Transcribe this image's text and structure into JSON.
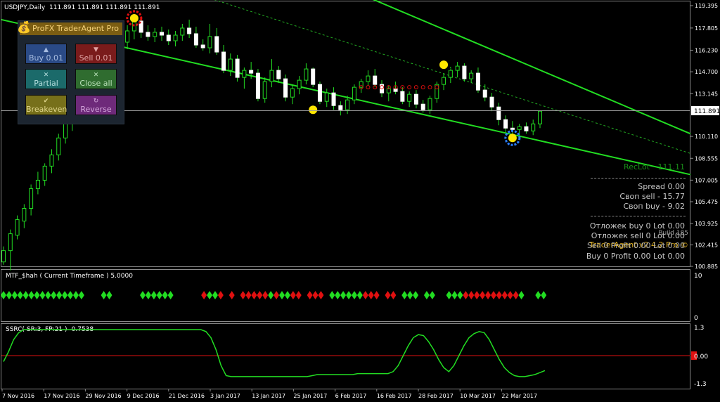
{
  "header": {
    "symbol_title": "USDJPY,Daily",
    "ohlc": "111.891 111.891 111.891 111.891"
  },
  "panel": {
    "title": "ProFX TraderAgent Pro",
    "buy_label": "Buy 0.01",
    "sell_label": "Sell 0.01",
    "partial_label": "Partial",
    "close_all_label": "Close all",
    "breakeven_label": "Breakeven",
    "reverse_label": "Reverse",
    "icons": {
      "buy": "arrow-up",
      "sell": "arrow-down",
      "partial": "x-mark",
      "close_all": "x-mark",
      "breakeven": "check-mark",
      "reverse": "circular-arrows"
    }
  },
  "price_axis": {
    "ticks": [
      "119.395",
      "117.805",
      "116.230",
      "114.700",
      "113.145",
      "111.891",
      "110.110",
      "108.555",
      "107.005",
      "105.475",
      "103.925",
      "102.415",
      "100.885"
    ],
    "current_price": "111.891"
  },
  "info": {
    "reclot": "RecLot",
    "reclot_value": "111.11",
    "spread": "Spread    0.00",
    "swap_sell": "Своп sell  - 15.77",
    "swap_buy": "Своп buy  - 9.02",
    "pending_buy": "Отложек buy 0  Lot 0.00",
    "pending_sell": "Отложек sell 0  Lot 0.00",
    "build": "Build 185",
    "version": "TraderAgent v2.4.2 Pro ©",
    "sell_line": "Sell 0  Profit 0.00  Lot 0.00",
    "buy_line": "Buy 0  Profit 0.00  Lot 0.00"
  },
  "indicator1": {
    "title": "MTF_$hah ( Current Timeframe )  5.0000",
    "scale_top": "10",
    "scale_bottom": "0",
    "colors": "GGGGGGGGGGGGGGG   GG     GGGGGG     RGGR R RRRRRGRGGRR RRR GGGGGGRRR RR GGG GG  GGGRRRRRRRRRRG  GG"
  },
  "indicator2": {
    "title": "SSRC( SR:3, FP:21 ) -0.7538",
    "scale_top": "1.3",
    "scale_mid": "0.00",
    "scale_bottom": "-1.3",
    "curve": [
      -0.3,
      0.2,
      0.8,
      1.15,
      1.3,
      1.3,
      1.3,
      1.3,
      1.3,
      1.3,
      1.3,
      1.3,
      1.3,
      1.3,
      1.3,
      1.3,
      1.3,
      1.3,
      1.3,
      1.3,
      1.3,
      1.3,
      1.3,
      1.3,
      1.3,
      1.3,
      1.3,
      1.3,
      1.3,
      1.3,
      1.3,
      1.3,
      1.3,
      1.3,
      1.3,
      1.3,
      1.3,
      1.3,
      1.3,
      1.3,
      1.2,
      0.9,
      0.3,
      -0.5,
      -1.0,
      -1.05,
      -1.05,
      -1.05,
      -1.05,
      -1.05,
      -1.05,
      -1.05,
      -1.05,
      -1.05,
      -1.05,
      -1.05,
      -1.05,
      -1.05,
      -1.05,
      -1.05,
      -1.05,
      -1.0,
      -0.95,
      -0.95,
      -0.95,
      -0.95,
      -0.95,
      -0.95,
      -0.95,
      -0.95,
      -0.9,
      -0.9,
      -0.9,
      -0.9,
      -0.9,
      -0.9,
      -0.9,
      -0.8,
      -0.5,
      0.0,
      0.5,
      0.9,
      1.05,
      1.0,
      0.7,
      0.3,
      -0.2,
      -0.6,
      -0.8,
      -0.5,
      0.0,
      0.5,
      0.9,
      1.1,
      1.2,
      1.15,
      0.8,
      0.3,
      -0.2,
      -0.6,
      -0.85,
      -1.0,
      -1.05,
      -1.05,
      -1.0,
      -0.95,
      -0.85,
      -0.75
    ]
  },
  "time_axis": [
    "7 Nov 2016",
    "17 Nov 2016",
    "29 Nov 2016",
    "9 Dec 2016",
    "21 Dec 2016",
    "3 Jan 2017",
    "13 Jan 2017",
    "25 Jan 2017",
    "6 Feb 2017",
    "16 Feb 2017",
    "28 Feb 2017",
    "10 Mar 2017",
    "22 Mar 2017"
  ],
  "chart_data": {
    "type": "candlestick",
    "symbol": "USDJPY",
    "timeframe": "Daily",
    "ylim": [
      100.885,
      119.395
    ],
    "candles": [
      [
        101.2,
        102.3,
        101.0,
        102.0
      ],
      [
        102.0,
        103.5,
        100.6,
        103.2
      ],
      [
        103.1,
        104.5,
        102.8,
        104.2
      ],
      [
        104.1,
        105.3,
        103.6,
        105.0
      ],
      [
        105.0,
        106.7,
        104.5,
        106.4
      ],
      [
        106.4,
        107.6,
        106.0,
        107.0
      ],
      [
        107.0,
        108.2,
        106.6,
        108.0
      ],
      [
        108.0,
        109.2,
        107.5,
        108.8
      ],
      [
        108.8,
        110.3,
        108.4,
        110.0
      ],
      [
        110.0,
        111.4,
        109.6,
        111.0
      ],
      [
        111.0,
        112.6,
        110.5,
        112.2
      ],
      [
        112.2,
        113.6,
        111.8,
        112.9
      ],
      [
        112.9,
        114.2,
        112.4,
        113.6
      ],
      [
        113.6,
        114.6,
        113.0,
        113.8
      ],
      [
        113.8,
        115.0,
        113.2,
        114.5
      ],
      [
        114.5,
        115.8,
        114.0,
        115.3
      ],
      [
        115.3,
        116.4,
        114.8,
        115.9
      ],
      [
        115.9,
        117.2,
        115.4,
        116.8
      ],
      [
        116.8,
        118.0,
        116.3,
        117.6
      ],
      [
        117.6,
        118.7,
        117.0,
        118.3
      ],
      [
        118.3,
        118.4,
        117.1,
        117.5
      ],
      [
        117.5,
        118.0,
        116.9,
        117.2
      ],
      [
        117.2,
        117.8,
        116.8,
        117.5
      ],
      [
        117.5,
        117.9,
        116.9,
        117.3
      ],
      [
        117.3,
        117.7,
        116.6,
        116.9
      ],
      [
        116.9,
        117.6,
        116.5,
        117.3
      ],
      [
        117.3,
        118.1,
        116.9,
        117.8
      ],
      [
        117.8,
        118.4,
        117.1,
        117.4
      ],
      [
        117.4,
        117.9,
        116.4,
        116.6
      ],
      [
        116.6,
        117.0,
        116.2,
        116.4
      ],
      [
        116.4,
        118.1,
        116.0,
        117.2
      ],
      [
        117.2,
        117.8,
        115.9,
        116.1
      ],
      [
        116.1,
        116.6,
        114.6,
        114.8
      ],
      [
        114.8,
        116.0,
        114.4,
        115.6
      ],
      [
        115.6,
        115.9,
        114.0,
        114.3
      ],
      [
        114.3,
        115.0,
        113.5,
        114.8
      ],
      [
        114.8,
        115.4,
        114.2,
        114.6
      ],
      [
        114.6,
        114.9,
        112.6,
        112.8
      ],
      [
        112.8,
        114.3,
        112.5,
        114.0
      ],
      [
        114.0,
        115.6,
        113.6,
        114.8
      ],
      [
        114.8,
        115.1,
        113.9,
        114.2
      ],
      [
        114.2,
        114.5,
        112.6,
        112.9
      ],
      [
        112.9,
        113.8,
        112.4,
        113.5
      ],
      [
        113.5,
        114.4,
        113.1,
        114.1
      ],
      [
        114.1,
        115.3,
        113.8,
        114.9
      ],
      [
        114.9,
        115.0,
        113.6,
        113.8
      ],
      [
        113.8,
        114.0,
        112.4,
        112.6
      ],
      [
        112.6,
        113.5,
        112.2,
        113.2
      ],
      [
        113.2,
        113.6,
        112.0,
        112.3
      ],
      [
        112.3,
        112.6,
        111.6,
        112.0
      ],
      [
        112.0,
        113.0,
        111.7,
        112.7
      ],
      [
        112.7,
        113.8,
        112.4,
        113.6
      ],
      [
        113.6,
        114.2,
        113.2,
        114.0
      ],
      [
        114.0,
        114.8,
        113.7,
        114.4
      ],
      [
        114.4,
        114.9,
        113.6,
        113.8
      ],
      [
        113.8,
        114.1,
        112.9,
        113.2
      ],
      [
        113.2,
        113.7,
        112.6,
        113.5
      ],
      [
        113.5,
        114.0,
        113.1,
        113.3
      ],
      [
        113.3,
        113.6,
        112.4,
        112.6
      ],
      [
        112.6,
        113.3,
        112.2,
        113.1
      ],
      [
        113.1,
        113.4,
        112.1,
        112.4
      ],
      [
        112.4,
        112.7,
        111.8,
        112.0
      ],
      [
        112.0,
        113.0,
        111.7,
        112.8
      ],
      [
        112.8,
        114.0,
        112.5,
        113.8
      ],
      [
        113.8,
        114.6,
        113.4,
        114.3
      ],
      [
        114.3,
        115.1,
        113.9,
        114.8
      ],
      [
        114.8,
        115.4,
        114.3,
        115.1
      ],
      [
        115.1,
        115.3,
        114.0,
        114.2
      ],
      [
        114.2,
        114.8,
        113.9,
        114.6
      ],
      [
        114.6,
        115.0,
        113.2,
        113.4
      ],
      [
        113.4,
        113.8,
        112.6,
        112.9
      ],
      [
        112.9,
        113.2,
        111.9,
        112.2
      ],
      [
        112.2,
        112.5,
        110.9,
        111.3
      ],
      [
        111.3,
        111.6,
        110.4,
        110.7
      ],
      [
        110.7,
        111.2,
        110.1,
        110.6
      ],
      [
        110.6,
        111.0,
        110.1,
        110.8
      ],
      [
        110.8,
        111.1,
        110.3,
        110.5
      ],
      [
        110.5,
        111.3,
        110.2,
        111.0
      ],
      [
        111.0,
        111.9,
        110.7,
        111.9
      ]
    ],
    "channel_upper": [
      [
        0,
        131.0
      ],
      [
        1,
        110.3
      ]
    ],
    "channel_lower": [
      [
        0,
        118.4
      ],
      [
        1,
        107.4
      ]
    ],
    "channel_mid": [
      [
        0,
        124.7
      ],
      [
        1,
        108.9
      ]
    ]
  }
}
